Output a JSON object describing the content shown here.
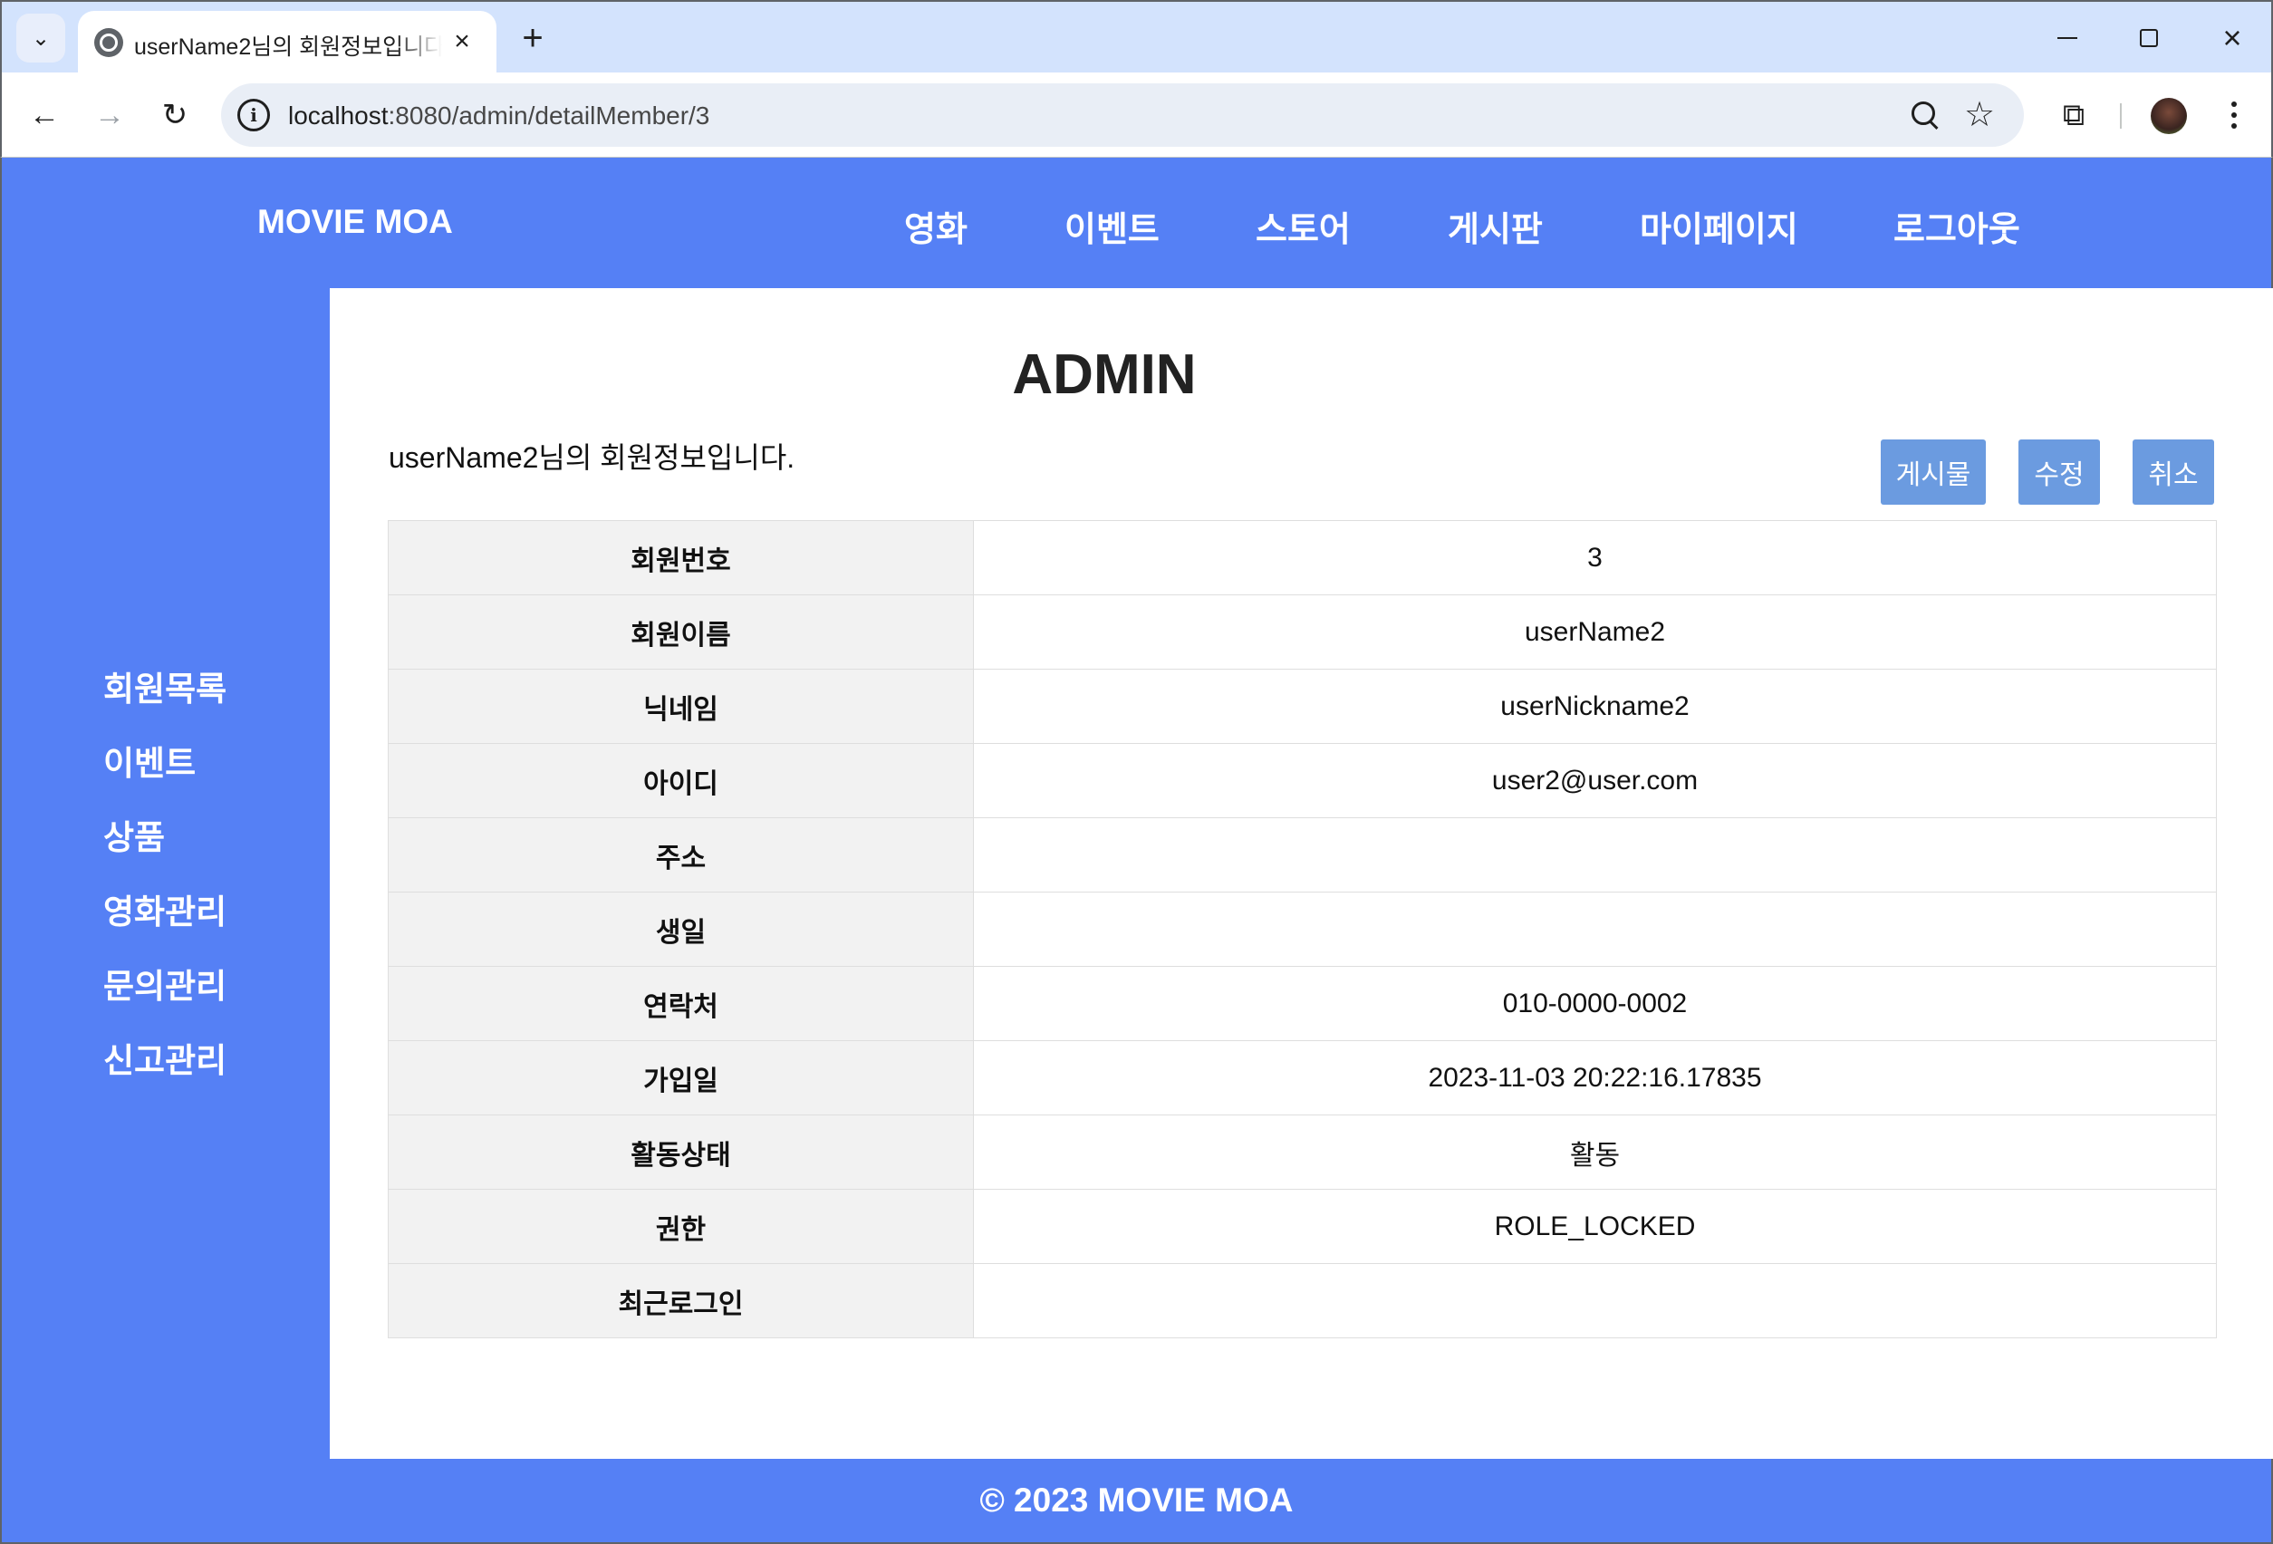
{
  "browser": {
    "tab_title": "userName2님의 회원정보입니다",
    "url_host": "localhost",
    "url_path": ":8080/admin/detailMember/3",
    "icons": {
      "tab_search": "chevron-down-icon",
      "favicon": "globe-icon",
      "close": "close-icon",
      "new_tab": "plus-icon",
      "back": "back-arrow-icon",
      "forward": "forward-arrow-icon",
      "reload": "reload-icon",
      "site_info": "info-icon",
      "zoom": "zoom-icon",
      "bookmark": "star-icon",
      "extensions": "puzzle-icon",
      "menu": "kebab-menu-icon"
    }
  },
  "site": {
    "brand": "MOVIE MOA",
    "nav": [
      "영화",
      "이벤트",
      "스토어",
      "게시판",
      "마이페이지",
      "로그아웃"
    ]
  },
  "sidebar": {
    "items": [
      "회원목록",
      "이벤트",
      "상품",
      "영화관리",
      "문의관리",
      "신고관리"
    ]
  },
  "main": {
    "heading": "ADMIN",
    "caption": "userName2님의 회원정보입니다.",
    "buttons": [
      "게시물",
      "수정",
      "취소"
    ],
    "rows": [
      {
        "label": "회원번호",
        "value": "3"
      },
      {
        "label": "회원이름",
        "value": "userName2"
      },
      {
        "label": "닉네임",
        "value": "userNickname2"
      },
      {
        "label": "아이디",
        "value": "user2@user.com"
      },
      {
        "label": "주소",
        "value": ""
      },
      {
        "label": "생일",
        "value": ""
      },
      {
        "label": "연락처",
        "value": "010-0000-0002"
      },
      {
        "label": "가입일",
        "value": "2023-11-03 20:22:16.17835"
      },
      {
        "label": "활동상태",
        "value": "활동"
      },
      {
        "label": "권한",
        "value": "ROLE_LOCKED"
      },
      {
        "label": "최근로그인",
        "value": ""
      }
    ]
  },
  "footer": {
    "text": "© 2023 MOVIE MOA"
  },
  "colors": {
    "page_blue": "#5580f5",
    "button_blue": "#6b9be0",
    "table_header_bg": "#f2f2f2",
    "chrome_tab_strip": "#d3e3fd"
  }
}
